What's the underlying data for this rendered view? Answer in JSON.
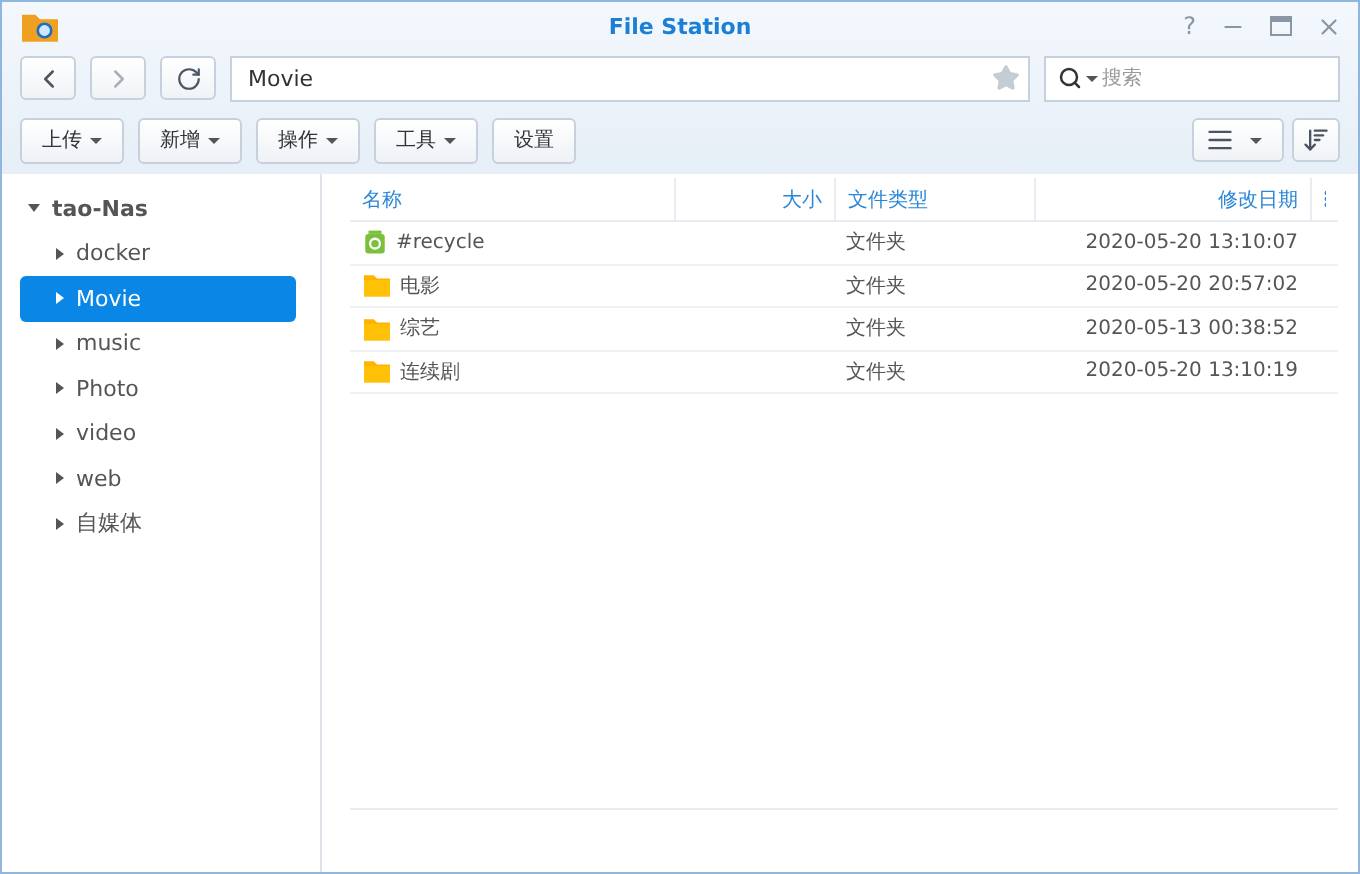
{
  "window": {
    "title": "File Station",
    "help_glyph": "?"
  },
  "nav": {
    "path": "Movie",
    "search_placeholder": "搜索"
  },
  "toolbar": {
    "buttons": [
      {
        "label": "上传",
        "dropdown": true
      },
      {
        "label": "新增",
        "dropdown": true
      },
      {
        "label": "操作",
        "dropdown": true
      },
      {
        "label": "工具",
        "dropdown": true
      },
      {
        "label": "设置",
        "dropdown": false
      }
    ]
  },
  "sidebar": {
    "tree": [
      {
        "label": "tao-Nas",
        "expanded": true,
        "selected": false,
        "children": [
          {
            "label": "docker",
            "expanded": false,
            "selected": false
          },
          {
            "label": "Movie",
            "expanded": false,
            "selected": true
          },
          {
            "label": "music",
            "expanded": false,
            "selected": false
          },
          {
            "label": "Photo",
            "expanded": false,
            "selected": false
          },
          {
            "label": "video",
            "expanded": false,
            "selected": false
          },
          {
            "label": "web",
            "expanded": false,
            "selected": false
          },
          {
            "label": "自媒体",
            "expanded": false,
            "selected": false
          }
        ]
      }
    ]
  },
  "table": {
    "columns": [
      {
        "label": "名称"
      },
      {
        "label": "大小"
      },
      {
        "label": "文件类型"
      },
      {
        "label": "修改日期"
      }
    ],
    "rows": [
      {
        "kind": "recycle",
        "name": "#recycle",
        "type": "文件夹",
        "modified": "2020-05-20 13:10:07"
      },
      {
        "kind": "folder",
        "name": "电影",
        "type": "文件夹",
        "modified": "2020-05-20 20:57:02"
      },
      {
        "kind": "folder",
        "name": "综艺",
        "type": "文件夹",
        "modified": "2020-05-13 00:38:52"
      },
      {
        "kind": "folder",
        "name": "连续剧",
        "type": "文件夹",
        "modified": "2020-05-20 13:10:19"
      }
    ]
  }
}
